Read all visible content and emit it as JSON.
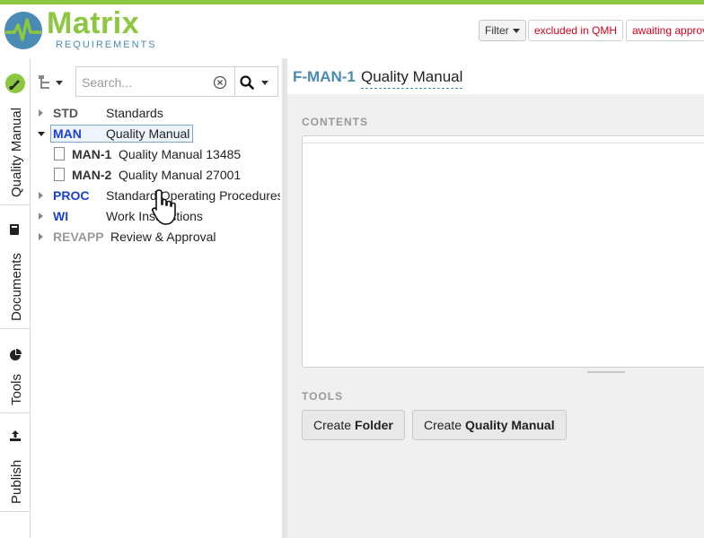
{
  "header": {
    "logo_word": "Matrix",
    "logo_sub": "REQUIREMENTS",
    "filter_label": "Filter",
    "tags": [
      "excluded in QMH",
      "awaiting approval"
    ]
  },
  "siderail": {
    "tabs": [
      {
        "label": "Quality Manual",
        "icon": "brush-icon"
      },
      {
        "label": "Documents",
        "icon": "book-icon"
      },
      {
        "label": "Tools",
        "icon": "pie-chart-icon"
      },
      {
        "label": "Publish",
        "icon": "upload-icon"
      }
    ]
  },
  "tree": {
    "search_placeholder": "Search...",
    "items": [
      {
        "code": "STD",
        "label": "Standards"
      },
      {
        "code": "MAN",
        "label": "Quality Manual"
      },
      {
        "code": "MAN-1",
        "label": "Quality Manual 13485"
      },
      {
        "code": "MAN-2",
        "label": "Quality Manual 27001"
      },
      {
        "code": "PROC",
        "label": "Standard Operating Procedures"
      },
      {
        "code": "WI",
        "label": "Work Instructions"
      },
      {
        "code": "REVAPP",
        "label": "Review & Approval"
      }
    ]
  },
  "main": {
    "item_id": "F-MAN-1",
    "item_title": "Quality Manual",
    "contents_label": "CONTENTS",
    "tools_label": "TOOLS",
    "btn_folder_prefix": "Create",
    "btn_folder_bold": "Folder",
    "btn_qm_prefix": "Create",
    "btn_qm_bold": "Quality Manual"
  },
  "colors": {
    "brand_green": "#8dc63f",
    "brand_blue": "#4a8bb5",
    "tag_red": "#d9001b",
    "code_blue": "#1a3fd4"
  }
}
